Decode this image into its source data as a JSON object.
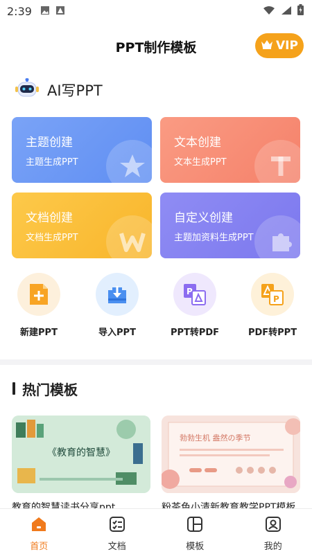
{
  "status_bar": {
    "time": "2:39"
  },
  "header": {
    "title": "PPT制作模板",
    "vip_label": "VIP"
  },
  "ai": {
    "label": "AI写PPT"
  },
  "cards": [
    {
      "title": "主题创建",
      "subtitle": "主题生成PPT",
      "color_from": "#7aa3f7",
      "color_to": "#5f8ef2",
      "icon": "star-icon"
    },
    {
      "title": "文本创建",
      "subtitle": "文本生成PPT",
      "color_from": "#fa9b83",
      "color_to": "#f5816a",
      "icon": "letter-t-icon"
    },
    {
      "title": "文档创建",
      "subtitle": "文档生成PPT",
      "color_from": "#fdc94a",
      "color_to": "#f8b52b",
      "icon": "letter-w-icon"
    },
    {
      "title": "自定义创建",
      "subtitle": "主题加资料生成PPT",
      "color_from": "#8f8cf4",
      "color_to": "#7c78ee",
      "icon": "puzzle-icon"
    }
  ],
  "tools": [
    {
      "label": "新建PPT",
      "icon": "new-file-icon"
    },
    {
      "label": "导入PPT",
      "icon": "import-icon"
    },
    {
      "label": "PPT转PDF",
      "icon": "ppt-to-pdf-icon"
    },
    {
      "label": "PDF转PPT",
      "icon": "pdf-to-ppt-icon"
    }
  ],
  "hot": {
    "title": "热门模板",
    "templates": [
      {
        "name": "教育的智慧读书分享ppt",
        "thumb_title": "《教育的智慧》"
      },
      {
        "name": "粉茶色小清新教育教学PPT模板",
        "thumb_title": "勃勃生机 盎然の季节"
      }
    ]
  },
  "nav": [
    {
      "label": "首页",
      "icon": "home-icon",
      "active": true
    },
    {
      "label": "文档",
      "icon": "document-icon",
      "active": false
    },
    {
      "label": "模板",
      "icon": "template-icon",
      "active": false
    },
    {
      "label": "我的",
      "icon": "profile-icon",
      "active": false
    }
  ],
  "colors": {
    "accent": "#f07a1c",
    "vip": "#f5a21b"
  }
}
